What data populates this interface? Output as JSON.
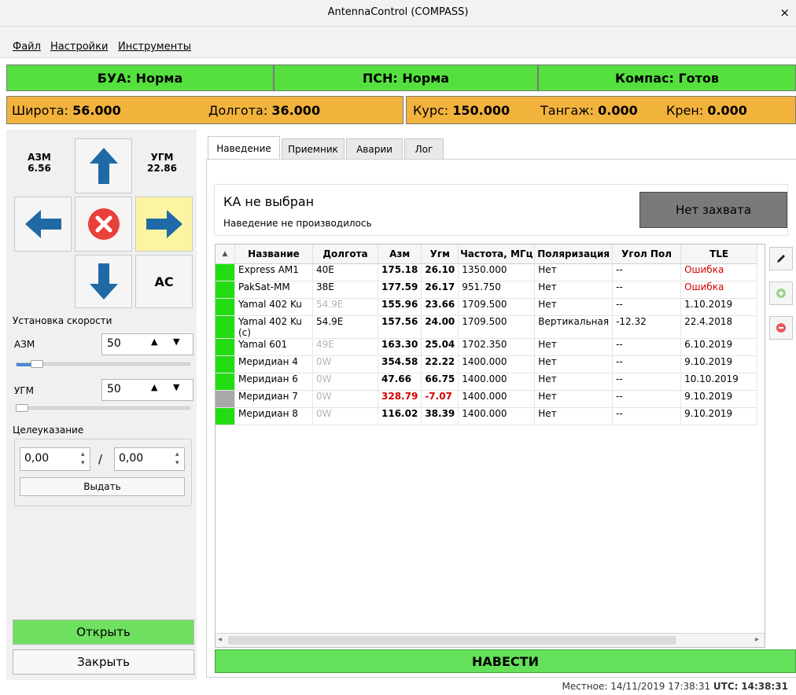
{
  "window": {
    "title": "AntennaControl (COMPASS)",
    "close_glyph": "×"
  },
  "menu": [
    "Файл",
    "Настройки",
    "Инструменты"
  ],
  "status": {
    "bua": "БУА: Норма",
    "psn": "ПСН: Норма",
    "compass": "Компас: Готов",
    "color_ok": "#55e03f"
  },
  "nav": {
    "lat_label": "Широта:",
    "lat_value": "56.000",
    "lon_label": "Долгота:",
    "lon_value": "36.000",
    "course_label": "Курс:",
    "course_value": "150.000",
    "pitch_label": "Тангаж:",
    "pitch_value": "0.000",
    "roll_label": "Крен:",
    "roll_value": "0.000",
    "color_warn": "#f2b33d"
  },
  "control": {
    "azm_label": "АЗМ",
    "azm_value": "6.56",
    "ugm_label": "УГМ",
    "ugm_value": "22.86",
    "ac_label": "AC",
    "speed_title": "Установка скорости",
    "speed_azm_label": "АЗМ",
    "speed_azm_value": "50",
    "speed_ugm_label": "УГМ",
    "speed_ugm_value": "50",
    "speed_azm_level": 0.12,
    "speed_ugm_level": 0.0,
    "target_title": "Целеуказание",
    "target_azm": "0,00",
    "target_sep": "/",
    "target_ugm": "0,00",
    "issue_label": "Выдать",
    "open_label": "Открыть",
    "close_label": "Закрыть"
  },
  "tabs": [
    "Наведение",
    "Приемник",
    "Аварии",
    "Лог"
  ],
  "pointing": {
    "sat_title": "КА не выбран",
    "sat_status": "Наведение не производилось",
    "capture_label": "Нет захвата"
  },
  "table": {
    "sort_glyph": "▲",
    "headers": [
      "Название",
      "Долгота",
      "Азм",
      "Угм",
      "Частота, МГц",
      "Поляризация",
      "Угол Пол",
      "TLE"
    ],
    "rows": [
      {
        "indicator": "#22dd11",
        "name": "Express AM1",
        "lon": "40E",
        "lon_grey": false,
        "azm": "175.18",
        "ugm": "26.10",
        "freq": "1350.000",
        "pol": "Нет",
        "ang": "--",
        "tle": "Ошибка",
        "tle_red": true,
        "red": false
      },
      {
        "indicator": "#22dd11",
        "name": "PakSat-MM",
        "lon": "38E",
        "lon_grey": false,
        "azm": "177.59",
        "ugm": "26.17",
        "freq": "951.750",
        "pol": "Нет",
        "ang": "--",
        "tle": "Ошибка",
        "tle_red": true,
        "red": false
      },
      {
        "indicator": "#22dd11",
        "name": "Yamal 402 Ku",
        "lon": "54.9E",
        "lon_grey": true,
        "azm": "155.96",
        "ugm": "23.66",
        "freq": "1709.500",
        "pol": "Нет",
        "ang": "--",
        "tle": "1.10.2019",
        "tle_red": false,
        "red": false
      },
      {
        "indicator": "#22dd11",
        "name": "Yamal 402 Ku (c)",
        "lon": "54.9E",
        "lon_grey": false,
        "azm": "157.56",
        "ugm": "24.00",
        "freq": "1709.500",
        "pol": "Вертикальная",
        "ang": "-12.32",
        "tle": "22.4.2018",
        "tle_red": false,
        "red": false
      },
      {
        "indicator": "#22dd11",
        "name": "Yamal 601",
        "lon": "49E",
        "lon_grey": true,
        "azm": "163.30",
        "ugm": "25.04",
        "freq": "1702.350",
        "pol": "Нет",
        "ang": "--",
        "tle": "6.10.2019",
        "tle_red": false,
        "red": false
      },
      {
        "indicator": "#22dd11",
        "name": "Меридиан 4",
        "lon": "0W",
        "lon_grey": true,
        "azm": "354.58",
        "ugm": "22.22",
        "freq": "1400.000",
        "pol": "Нет",
        "ang": "--",
        "tle": "9.10.2019",
        "tle_red": false,
        "red": false
      },
      {
        "indicator": "#22dd11",
        "name": "Меридиан 6",
        "lon": "0W",
        "lon_grey": true,
        "azm": "47.66",
        "ugm": "66.75",
        "freq": "1400.000",
        "pol": "Нет",
        "ang": "--",
        "tle": "10.10.2019",
        "tle_red": false,
        "red": false
      },
      {
        "indicator": "#a8a8a8",
        "name": "Меридиан 7",
        "lon": "0W",
        "lon_grey": true,
        "azm": "328.79",
        "ugm": "-7.07",
        "freq": "1400.000",
        "pol": "Нет",
        "ang": "--",
        "tle": "9.10.2019",
        "tle_red": false,
        "red": true
      },
      {
        "indicator": "#22dd11",
        "name": "Меридиан 8",
        "lon": "0W",
        "lon_grey": true,
        "azm": "116.02",
        "ugm": "38.39",
        "freq": "1400.000",
        "pol": "Нет",
        "ang": "--",
        "tle": "9.10.2019",
        "tle_red": false,
        "red": false
      }
    ]
  },
  "side_icons": [
    "pencil-icon",
    "plus-circle-icon",
    "minus-circle-icon"
  ],
  "point_button": "НАВЕСТИ",
  "footer": {
    "local": "Местное: 14/11/2019 17:38:31",
    "utc_label": "UTC:",
    "utc_time": "14:38:31"
  }
}
